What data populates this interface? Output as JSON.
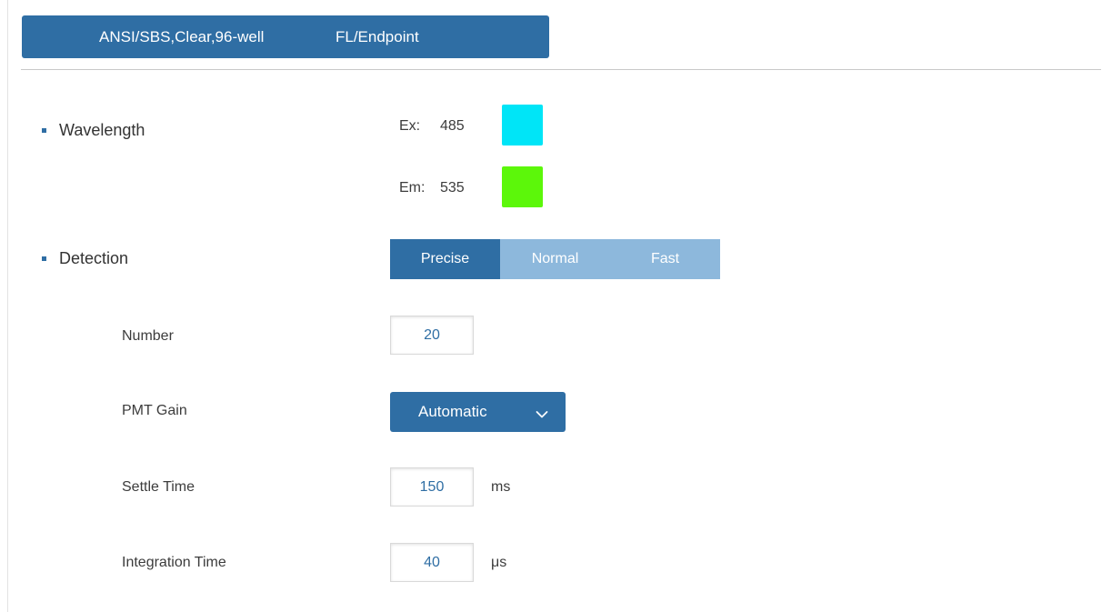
{
  "header": {
    "plate_type": "ANSI/SBS,Clear,96-well",
    "read_mode": "FL/Endpoint"
  },
  "wavelength": {
    "section_label": "Wavelength",
    "ex_label": "Ex:",
    "ex_value": "485",
    "ex_color": "#00e5f7",
    "em_label": "Em:",
    "em_value": "535",
    "em_color": "#5cf70a"
  },
  "detection": {
    "section_label": "Detection",
    "options": [
      "Precise",
      "Normal",
      "Fast"
    ],
    "selected": "Precise"
  },
  "fields": {
    "number_label": "Number",
    "number_value": "20",
    "pmt_gain_label": "PMT Gain",
    "pmt_gain_value": "Automatic",
    "settle_time_label": "Settle Time",
    "settle_time_value": "150",
    "settle_time_unit": "ms",
    "integration_time_label": "Integration Time",
    "integration_time_value": "40",
    "integration_time_unit": "μs"
  },
  "colors": {
    "accent": "#2f6ea4",
    "segment_inactive": "#8db8dc"
  },
  "icons": {
    "dropdown": "chevron-down-icon",
    "bullet": "square-bullet-icon"
  }
}
